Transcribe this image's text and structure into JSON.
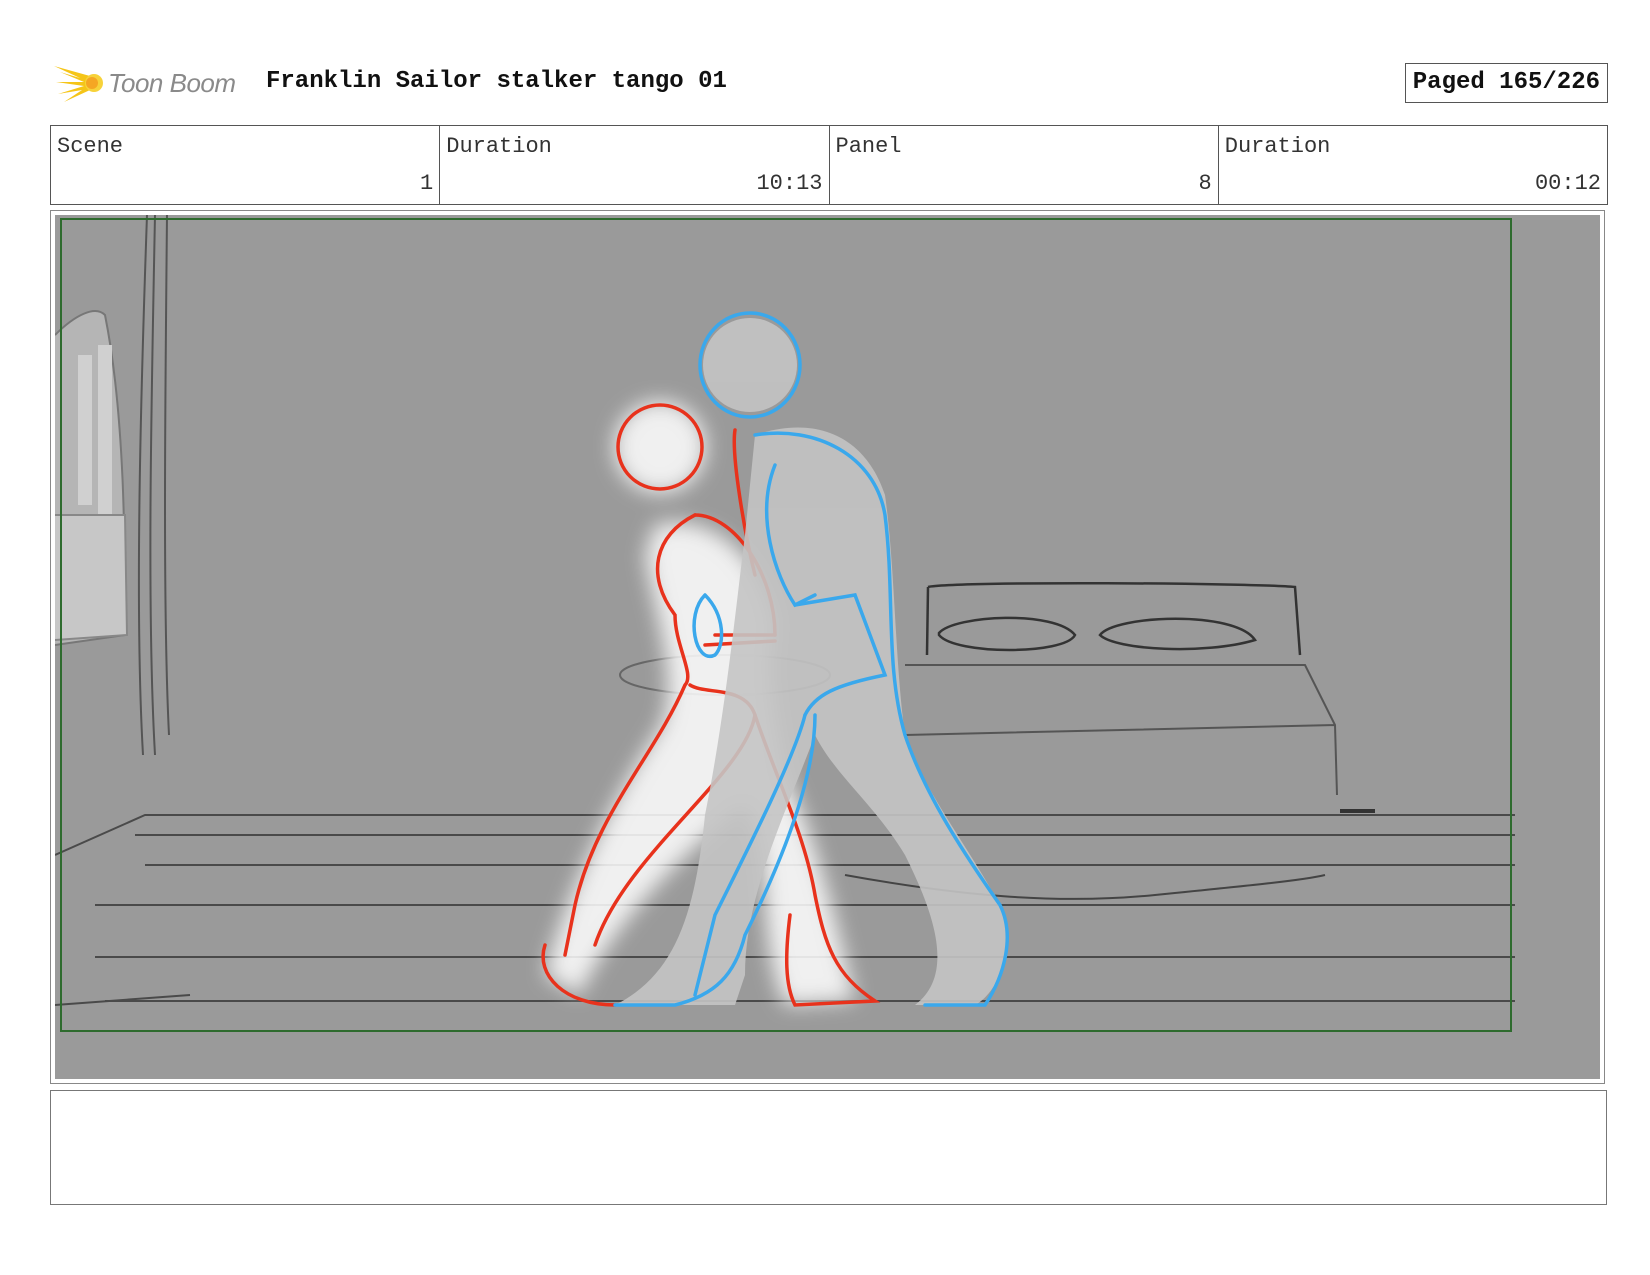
{
  "header": {
    "logo_text": "Toon Boom",
    "project_title": "Franklin Sailor stalker tango 01",
    "page_label": "Paged 165/226"
  },
  "info": {
    "scene_label": "Scene",
    "scene_value": "1",
    "scene_duration_label": "Duration",
    "scene_duration_value": "10:13",
    "panel_label": "Panel",
    "panel_value": "8",
    "panel_duration_label": "Duration",
    "panel_duration_value": "00:12"
  },
  "colors": {
    "background_gray": "#9a9a9a",
    "safe_frame_green": "#2e6b2e",
    "figure_red": "#e8321c",
    "figure_blue": "#3aa8ec",
    "logo_yellow": "#f5c518"
  },
  "notes": {
    "text": ""
  }
}
